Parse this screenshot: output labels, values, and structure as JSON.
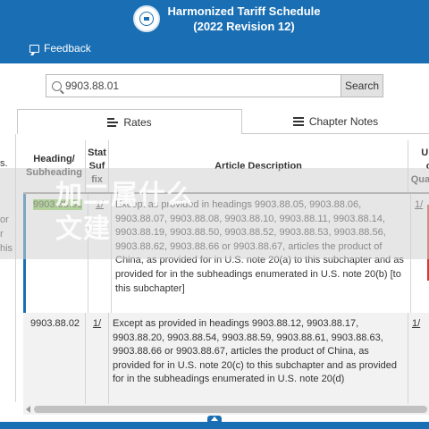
{
  "header": {
    "title_line1": "Harmonized Tariff Schedule",
    "title_line2": "(2022 Revision 12)",
    "feedback_label": "Feedback"
  },
  "search": {
    "value": "9903.88.01",
    "button_label": "Search"
  },
  "tabs": [
    {
      "label": "Rates",
      "icon": "list-icon",
      "active": true
    },
    {
      "label": "Chapter Notes",
      "icon": "list-icon",
      "active": false
    }
  ],
  "left_panel": {
    "fragments": [
      "s.",
      "or",
      "r",
      "his"
    ]
  },
  "table": {
    "columns": {
      "heading": [
        "Heading/",
        "Subheading"
      ],
      "stat_suffix": [
        "Stat",
        "Suf",
        "fix"
      ],
      "article_description": "Article Description",
      "unit": [
        "Unit",
        "of",
        "Quantity"
      ]
    },
    "rows": [
      {
        "heading": "9903.88.01",
        "stat_suffix": "1/",
        "description": "Except as provided in headings 9903.88.05, 9903.88.06, 9903.88.07, 9903.88.08, 9903.88.10, 9903.88.11, 9903.88.14, 9903.88.19, 9903.88.50, 9903.88.52, 9903.88.53, 9903.88.56, 9903.88.62, 9903.88.66 or 9903.88.67, articles the product of China, as provided for in U.S. note 20(a) to this subchapter and as provided for in the subheadings enumerated in U.S. note 20(b) [to this subchapter]",
        "unit": "1/"
      },
      {
        "heading": "9903.88.02",
        "stat_suffix": "1/",
        "description": "Except as provided in headings 9903.88.12, 9903.88.17, 9903.88.20, 9903.88.54, 9903.88.59, 9903.88.61, 9903.88.63, 9903.88.66 or 9903.88.67, articles the product of China, as provided for in U.S. note 20(c) to this subchapter and as provided for in the subheadings enumerated in U.S. note 20(d)",
        "unit": "1/"
      }
    ]
  },
  "overlay_banner": {
    "line1": "加二属什么",
    "line2": "文建"
  },
  "colors": {
    "brand_blue": "#1a6fb4",
    "highlight_green": "#8fd35a",
    "alt_row": "#f2f2f2",
    "marker_red": "#d7362a"
  }
}
